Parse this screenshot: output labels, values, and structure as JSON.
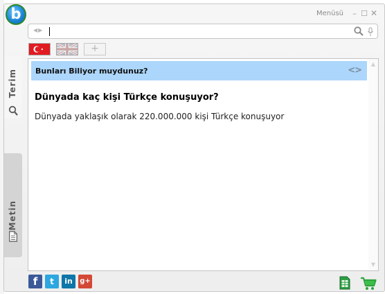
{
  "window": {
    "menu_label": "Menüsü",
    "logo_letter": "b"
  },
  "search": {
    "value": "",
    "placeholder": ""
  },
  "tabs": [
    {
      "name": "tab-turkish",
      "icon": "turkey-flag-icon"
    },
    {
      "name": "tab-english",
      "icon": "uk-flag-icon"
    },
    {
      "name": "tab-add",
      "label": "+"
    }
  ],
  "sidebar": {
    "terim_label": "Terim",
    "metin_label": "Metin"
  },
  "content": {
    "info_title": "Bunları Biliyor muydunuz?",
    "question": "Dünyada kaç kişi Türkçe konuşuyor?",
    "answer": "Dünyada yaklaşık olarak 220.000.000 kişi Türkçe konuşuyor"
  },
  "colors": {
    "banner": "#acd6fb",
    "logo_ring": "#2e8a2a",
    "facebook": "#3b5998",
    "twitter": "#2ca7e0",
    "linkedin": "#0e76a8",
    "googleplus": "#d34836"
  },
  "footer": {
    "social": [
      {
        "name": "facebook",
        "glyph": "f"
      },
      {
        "name": "twitter",
        "glyph": "t"
      },
      {
        "name": "linkedin",
        "glyph": "in"
      },
      {
        "name": "googleplus",
        "glyph": "g+"
      }
    ]
  }
}
